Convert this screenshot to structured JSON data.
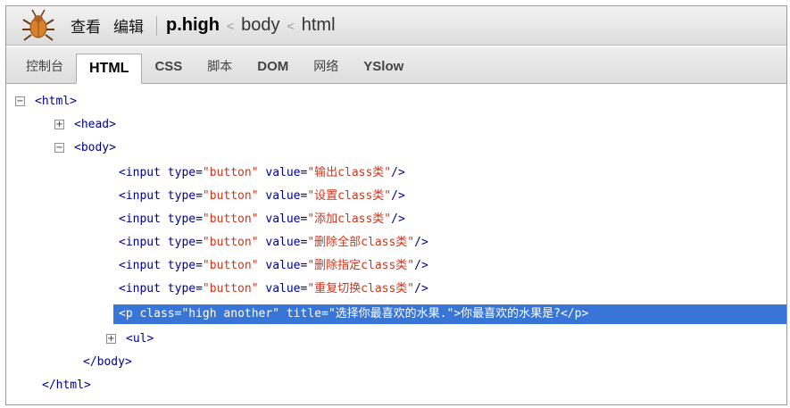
{
  "toolbar": {
    "menu_view": "查看",
    "menu_edit": "编辑",
    "breadcrumbs": [
      "p.high",
      "body",
      "html"
    ],
    "crumb_separator": "<"
  },
  "tabs": [
    "控制台",
    "HTML",
    "CSS",
    "脚本",
    "DOM",
    "网络",
    "YSlow"
  ],
  "selected_tab": "HTML",
  "tree": {
    "html_open": "<html>",
    "head": "<head>",
    "body_open": "<body>",
    "inputs": [
      {
        "pre": "<input type=",
        "type_val": "\"button\"",
        "mid": " value=",
        "val": "\"输出class类\"",
        "end": "/>"
      },
      {
        "pre": "<input type=",
        "type_val": "\"button\"",
        "mid": " value=",
        "val": "\"设置class类\"",
        "end": "/>"
      },
      {
        "pre": "<input type=",
        "type_val": "\"button\"",
        "mid": " value=",
        "val": "\"添加class类\"",
        "end": "/>"
      },
      {
        "pre": "<input type=",
        "type_val": "\"button\"",
        "mid": " value=",
        "val": "\"删除全部class类\"",
        "end": "/>"
      },
      {
        "pre": "<input type=",
        "type_val": "\"button\"",
        "mid": " value=",
        "val": "\"删除指定class类\"",
        "end": "/>"
      },
      {
        "pre": "<input type=",
        "type_val": "\"button\"",
        "mid": " value=",
        "val": "\"重复切换class类\"",
        "end": "/>"
      }
    ],
    "p_line": {
      "open": "<p class=",
      "class_val": "\"high another\"",
      "title_attr": " title=",
      "title_val": "\"选择你最喜欢的水果.\"",
      "gt": ">",
      "text": "你最喜欢的水果是?",
      "close": "</p>"
    },
    "ul": "<ul>",
    "body_close": "</body>",
    "html_close": "</html>",
    "toggle_expanded": "−",
    "toggle_collapsed": "+"
  },
  "colors": {
    "tag": "#00008b",
    "value": "#d0341b",
    "selection": "#3875d7"
  }
}
